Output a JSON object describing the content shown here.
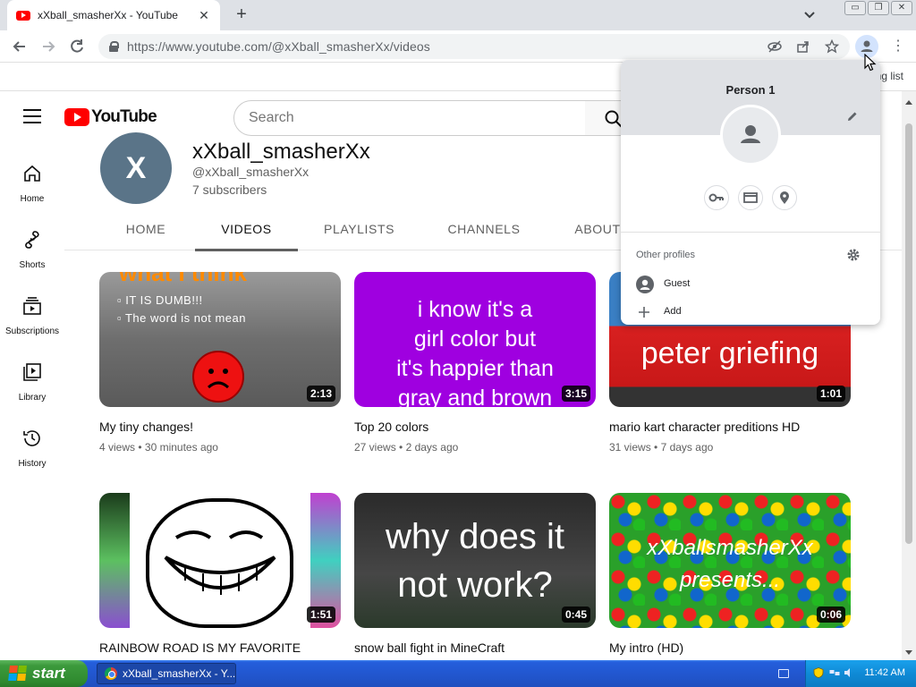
{
  "browser": {
    "tab_title": "xXball_smasherXx - YouTube",
    "new_tab_symbol": "+",
    "window_buttons": [
      "▭",
      "❐",
      "✕"
    ],
    "url": "https://www.youtube.com/@xXball_smasherXx/videos",
    "reading_list": "ing list"
  },
  "youtube": {
    "logo_text": "YouTube",
    "search_placeholder": "Search",
    "guide": [
      {
        "label": "Home",
        "icon": "home-icon"
      },
      {
        "label": "Shorts",
        "icon": "shorts-icon"
      },
      {
        "label": "Subscriptions",
        "icon": "subscriptions-icon"
      },
      {
        "label": "Library",
        "icon": "library-icon"
      },
      {
        "label": "History",
        "icon": "history-icon"
      }
    ],
    "channel": {
      "avatar_letter": "X",
      "name": "xXball_smasherXx",
      "handle": "@xXball_smasherXx",
      "subscribers": "7 subscribers"
    },
    "tabs": [
      "HOME",
      "VIDEOS",
      "PLAYLISTS",
      "CHANNELS",
      "ABOUT"
    ],
    "active_tab": "VIDEOS",
    "videos": [
      {
        "title": "My tiny changes!",
        "views": "4 views",
        "age": "30 minutes ago",
        "duration": "2:13",
        "thumb_text": [
          "what I think",
          "▫ IT IS DUMB!!!",
          "▫ The word is not mean"
        ]
      },
      {
        "title": "Top 20 colors",
        "views": "27 views",
        "age": "2 days ago",
        "duration": "3:15",
        "thumb_text": [
          "i know it's a",
          "girl color but",
          "it's happier than",
          "gray and brown"
        ]
      },
      {
        "title": "mario kart character preditions HD",
        "views": "31 views",
        "age": "7 days ago",
        "duration": "1:01",
        "thumb_text": [
          "peter griefing"
        ]
      },
      {
        "title": "RAINBOW ROAD IS MY FAVORITE",
        "duration": "1:51"
      },
      {
        "title": "snow ball fight in MineCraft",
        "duration": "0:45",
        "thumb_text": [
          "why does it",
          "not work?"
        ]
      },
      {
        "title": "My intro (HD)",
        "duration": "0:06",
        "thumb_text": [
          "xXballsmasherXx",
          "presents..."
        ]
      }
    ],
    "meta_separator": "•"
  },
  "profile_popup": {
    "name": "Person 1",
    "other_profiles_label": "Other profiles",
    "rows": [
      {
        "label": "Guest",
        "icon": "guest-avatar-icon"
      },
      {
        "label": "Add",
        "icon": "plus-icon"
      }
    ]
  },
  "taskbar": {
    "start_label": "start",
    "task_item": "xXball_smasherXx - Y...",
    "clock": "11:42 AM"
  },
  "colors": {
    "youtube_red": "#ff0000",
    "chrome_tabstrip": "#dee1e6",
    "taskbar_blue": "#245edb",
    "start_green": "#3c9a3c",
    "tray_blue": "#0f8ad6"
  }
}
